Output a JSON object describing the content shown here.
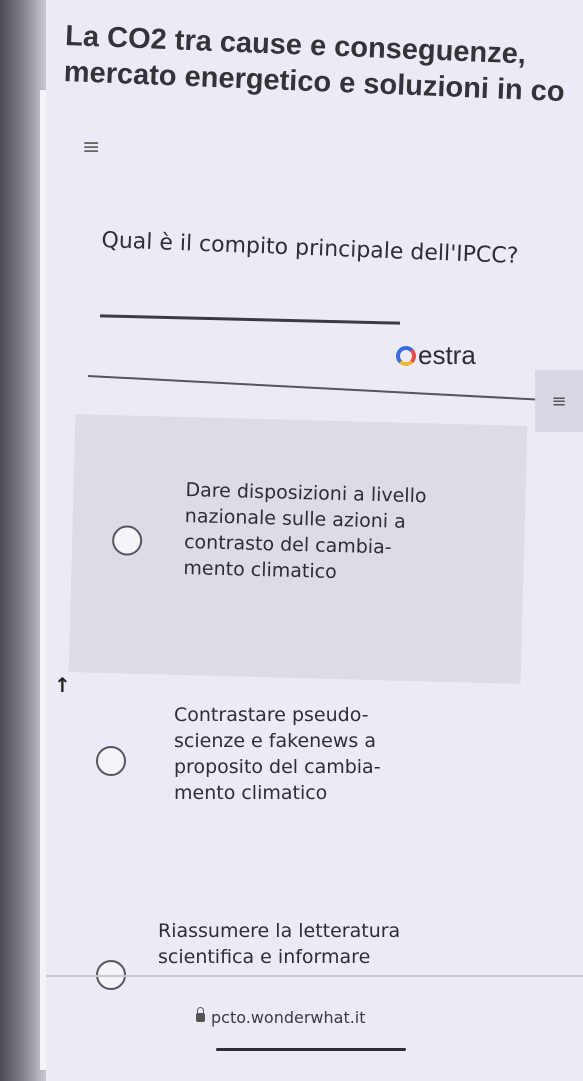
{
  "quiz": {
    "title": "La CO2 tra cause e conseguenze,\nmercato energetico e soluzioni in co",
    "question": "Qual è il compito principale dell'IPCC?",
    "brand": "estra",
    "options": [
      {
        "text": "Dare disposizioni a livello\nnazionale sulle azioni a\ncontrasto del cambia-\nmento climatico",
        "selected": false
      },
      {
        "text": "Contrastare pseudo-\nscienze e fakenews a\nproposito del cambia-\nmento climatico",
        "selected": false
      },
      {
        "text": "Riassumere la letteratura\nscientifica e informare",
        "selected": false
      }
    ]
  },
  "browser": {
    "url": "pcto.wonderwhat.it"
  },
  "icons": {
    "menu": "hamburger-icon",
    "lock": "lock-icon",
    "side": "hamburger-icon",
    "brand_mark": "estra-logo-mark-icon"
  },
  "colors": {
    "background": "#ecebf5",
    "selected_option_bg": "#dcdce6",
    "text": "#2d2d33"
  }
}
